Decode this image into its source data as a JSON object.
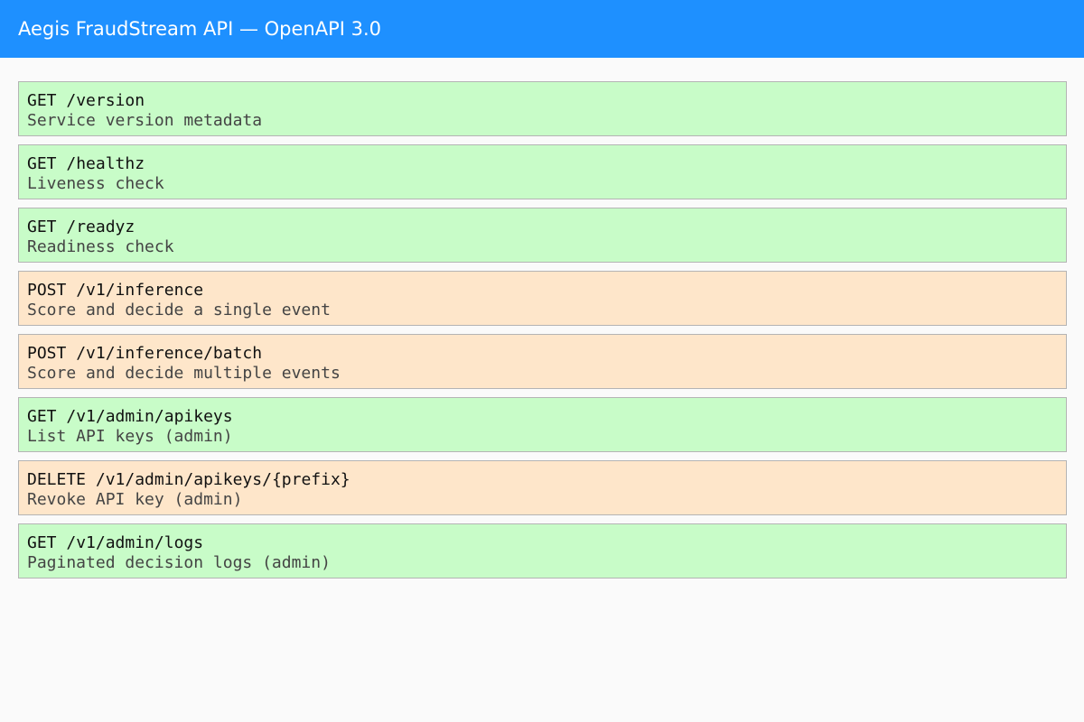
{
  "header": {
    "title": "Aegis FraudStream API — OpenAPI 3.0"
  },
  "endpoints": [
    {
      "method": "GET",
      "path": "/version",
      "summary": "Service version metadata"
    },
    {
      "method": "GET",
      "path": "/healthz",
      "summary": "Liveness check"
    },
    {
      "method": "GET",
      "path": "/readyz",
      "summary": "Readiness check"
    },
    {
      "method": "POST",
      "path": "/v1/inference",
      "summary": "Score and decide a single event"
    },
    {
      "method": "POST",
      "path": "/v1/inference/batch",
      "summary": "Score and decide multiple events"
    },
    {
      "method": "GET",
      "path": "/v1/admin/apikeys",
      "summary": "List API keys (admin)"
    },
    {
      "method": "DELETE",
      "path": "/v1/admin/apikeys/{prefix}",
      "summary": "Revoke API key (admin)"
    },
    {
      "method": "GET",
      "path": "/v1/admin/logs",
      "summary": "Paginated decision logs (admin)"
    }
  ],
  "colors": {
    "header": "#1e90ff",
    "get_background": "#c8fcc8",
    "mutation_background": "#fee6ca",
    "page_background": "#fafafa"
  }
}
